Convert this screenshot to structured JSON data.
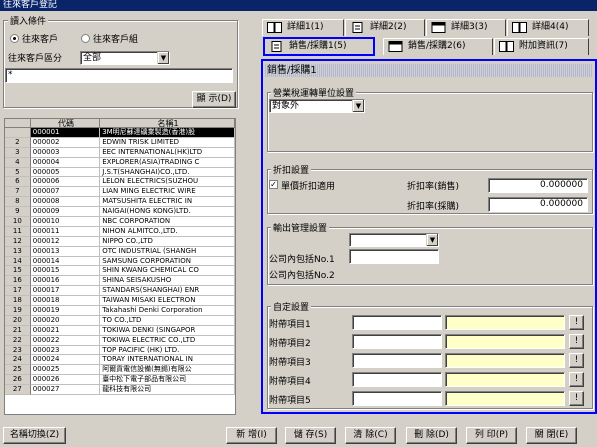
{
  "window": {
    "title": "往來客戶登記"
  },
  "left": {
    "group_title": "讀入條件",
    "radio_customer": "往來客戶",
    "radio_group": "往來客戶組",
    "category_label": "往來客戶區分",
    "category_value": "全部",
    "search_value": "*",
    "display_button": "顯 示(D)"
  },
  "grid": {
    "headers": [
      "",
      "代碼",
      "名稱1"
    ],
    "rows": [
      {
        "n": "",
        "code": "000001",
        "name": "3M明尼蘇達礦業製造(香港)股"
      },
      {
        "n": "2",
        "code": "000002",
        "name": "EDWIN TRISK LIMITED"
      },
      {
        "n": "3",
        "code": "000003",
        "name": "EEC INTERNATIONAL(HK)LTD"
      },
      {
        "n": "4",
        "code": "000004",
        "name": "EXPLORER(ASIA)TRADING C"
      },
      {
        "n": "5",
        "code": "000005",
        "name": "J.S.T(SHANGHAI)CO.,LTD."
      },
      {
        "n": "6",
        "code": "000006",
        "name": "LELON ELECTRICS(SUZHOU"
      },
      {
        "n": "7",
        "code": "000007",
        "name": "LIAN MING ELECTRIC WIRE"
      },
      {
        "n": "8",
        "code": "000008",
        "name": "MATSUSHITA ELECTRIC IN"
      },
      {
        "n": "9",
        "code": "000009",
        "name": "NAIGAI(HONG KONG)LTD."
      },
      {
        "n": "10",
        "code": "000010",
        "name": "NBC CORPORATION"
      },
      {
        "n": "11",
        "code": "000011",
        "name": "NIHON ALMITCO.,LTD."
      },
      {
        "n": "12",
        "code": "000012",
        "name": "NIPPO CO.,LTD"
      },
      {
        "n": "13",
        "code": "000013",
        "name": "OTC INDUSTRIAL (SHANGH"
      },
      {
        "n": "14",
        "code": "000014",
        "name": "SAMSUNG CORPORATION"
      },
      {
        "n": "15",
        "code": "000015",
        "name": "SHIN KWANG CHEMICAL CO"
      },
      {
        "n": "16",
        "code": "000016",
        "name": "SHINA SEISAKUSHO"
      },
      {
        "n": "17",
        "code": "000017",
        "name": "STANDARS(SHANGHAI) ENR"
      },
      {
        "n": "18",
        "code": "000018",
        "name": "TAIWAN MISAKI ELECTRON"
      },
      {
        "n": "19",
        "code": "000019",
        "name": "Takahashi Denki Corporation"
      },
      {
        "n": "20",
        "code": "000020",
        "name": "TO CO.,LTD"
      },
      {
        "n": "21",
        "code": "000021",
        "name": "TOKIWA DENKI (SINGAPOR"
      },
      {
        "n": "22",
        "code": "000022",
        "name": "TOKIWA ELECTRIC CO.,LTD"
      },
      {
        "n": "23",
        "code": "000023",
        "name": "TOP PACIFIC (HK) LTD."
      },
      {
        "n": "24",
        "code": "000024",
        "name": "TORAY INTERNATIONAL IN"
      },
      {
        "n": "25",
        "code": "000025",
        "name": "阿爾貢電信設備(無錫)有限公"
      },
      {
        "n": "26",
        "code": "000026",
        "name": "臺中松下電子部品有限公司"
      },
      {
        "n": "27",
        "code": "000027",
        "name": "龍科技有限公司"
      }
    ]
  },
  "tabs": {
    "detail1": "詳細1(1)",
    "detail2": "詳細2(2)",
    "detail3": "詳細3(3)",
    "detail4": "詳細4(4)",
    "sales1": "銷售/採購1(5)",
    "sales2": "銷售/採購2(6)",
    "extra": "附加資訊(7)"
  },
  "panel": {
    "header": "銷售/採購1",
    "tax_title": "營業稅運轉單位設置",
    "tax_value": "對象外",
    "discount_title": "折扣設置",
    "discount_check_label": "單價折扣適用",
    "discount_sales_label": "折扣率(銷售)",
    "discount_sales_value": "0.000000",
    "discount_purchase_label": "折扣率(採購)",
    "discount_purchase_value": "0.000000",
    "output_title": "輸出管理設置",
    "company_code1_label": "公司內包括No.1",
    "company_code2_label": "公司內包括No.2",
    "custom_title": "自定設置",
    "custom_items": [
      "附帶項目1",
      "附帶項目2",
      "附帶項目3",
      "附帶項目4",
      "附帶項目5"
    ],
    "custom_button": "!"
  },
  "bottom": {
    "switch_name": "名稱切換(Z)",
    "new": "新 增(I)",
    "save": "儲 存(S)",
    "clear": "清 除(C)",
    "delete": "刪 除(D)",
    "print": "列 印(P)",
    "close": "關 閉(E)"
  }
}
